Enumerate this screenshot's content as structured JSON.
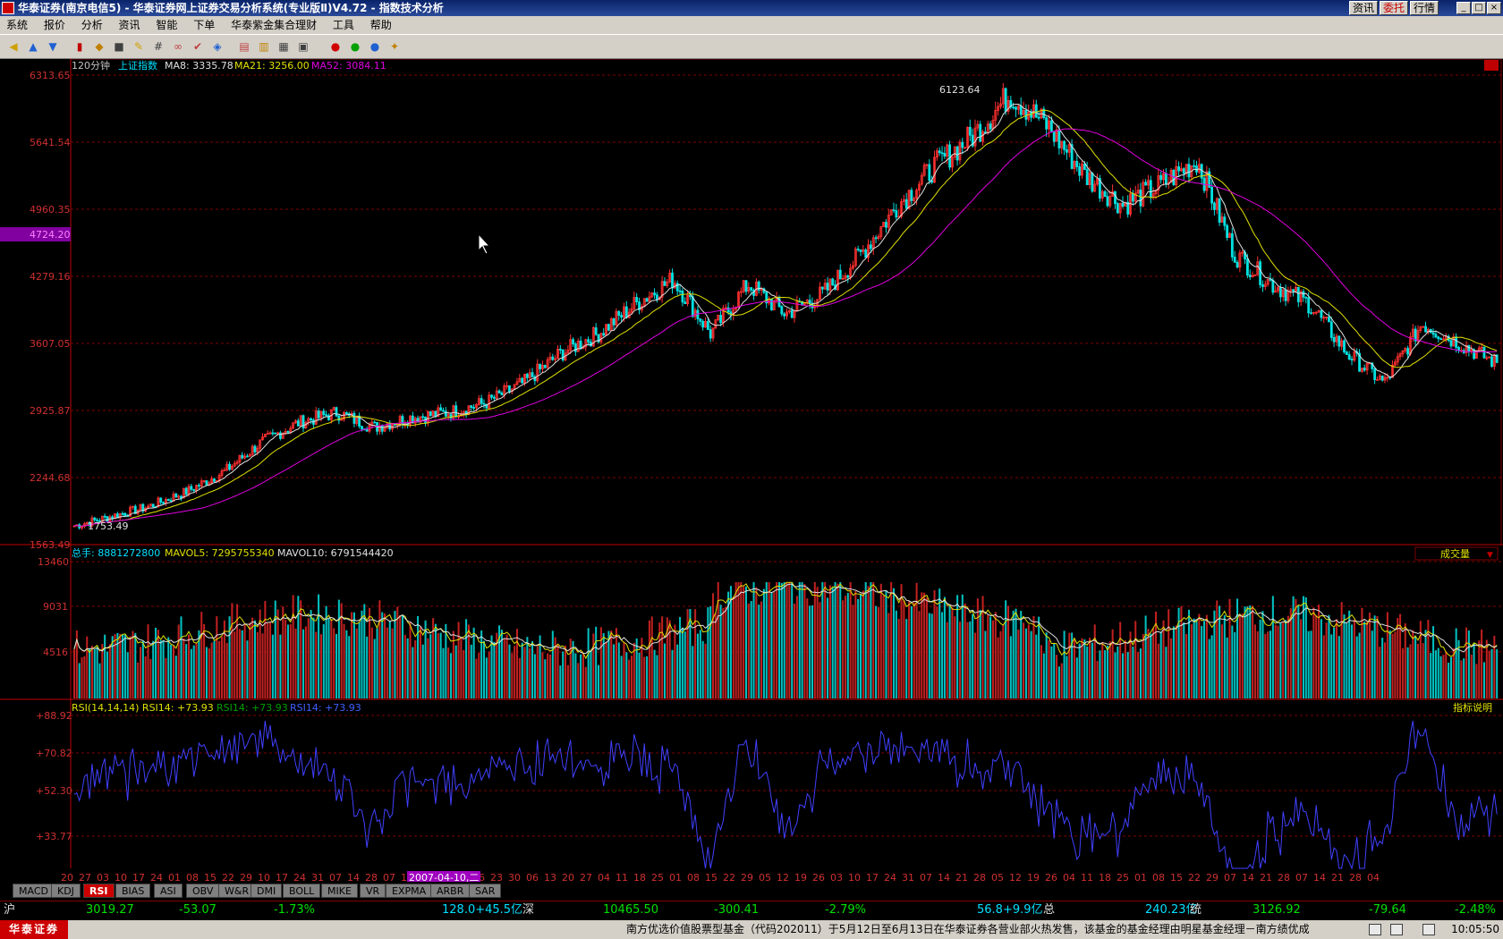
{
  "window": {
    "title": "华泰证券(南京电信5) - 华泰证券网上证券交易分析系统(专业版Ⅱ)V4.72 - 指数技术分析",
    "buttons": [
      "资讯",
      "委托",
      "行情"
    ],
    "controls": [
      "_",
      "□",
      "×"
    ]
  },
  "menu": [
    "系统",
    "报价",
    "分析",
    "资讯",
    "智能",
    "下单",
    "华泰紫金集合理财",
    "工具",
    "帮助"
  ],
  "main_chart": {
    "period": "120分钟",
    "name": "上证指数",
    "ma_legend": [
      {
        "label": "MA8: 3335.78",
        "color": "#e0e0e0"
      },
      {
        "label": "MA21: 3256.00",
        "color": "#e0e000"
      },
      {
        "label": "MA52: 3084.11",
        "color": "#e000e0"
      }
    ],
    "y_ticks": [
      "6313.65",
      "5641.54",
      "4960.35",
      "4279.16",
      "3607.05",
      "2925.87",
      "2244.68",
      "1563.49"
    ],
    "crosshair_value": "4724.20",
    "high_label": "6123.64",
    "low_label": "1753.49"
  },
  "volume_chart": {
    "legend": [
      {
        "label": "总手: 8881272800",
        "color": "#00e0ff"
      },
      {
        "label": "MAVOL5: 7295755340",
        "color": "#e0e000"
      },
      {
        "label": "MAVOL10: 6791544420",
        "color": "#e0e0e0"
      }
    ],
    "y_ticks": [
      "13460",
      "9031",
      "4516"
    ],
    "selector": "成交量"
  },
  "rsi_chart": {
    "legend": [
      {
        "label": "RSI(14,14,14) RSI14: +73.93",
        "color": "#e0e000"
      },
      {
        "label": "RSI14: +73.93",
        "color": "#00a000"
      },
      {
        "label": "RSI14: +73.93",
        "color": "#4040ff"
      }
    ],
    "y_ticks": [
      "+88.92",
      "+70.82",
      "+52.30",
      "+33.77"
    ],
    "help": "指标说明"
  },
  "x_axis": {
    "ticks": [
      "20",
      "27",
      "03",
      "10",
      "17",
      "24",
      "01",
      "08",
      "15",
      "22",
      "29",
      "10",
      "17",
      "24",
      "31",
      "07",
      "14",
      "28",
      "07",
      "1",
      "18",
      "25",
      "09",
      "16",
      "23",
      "30",
      "06",
      "13",
      "20",
      "27",
      "04",
      "11",
      "18",
      "25",
      "01",
      "08",
      "15",
      "22",
      "29",
      "05",
      "12",
      "19",
      "26",
      "03",
      "10",
      "17",
      "24",
      "31",
      "07",
      "14",
      "21",
      "28",
      "05",
      "12",
      "19",
      "26",
      "04",
      "11",
      "18",
      "25",
      "01",
      "08",
      "15",
      "22",
      "29",
      "07",
      "14",
      "21",
      "28",
      "07",
      "14",
      "21",
      "28",
      "04"
    ],
    "cursor_date": "2007-04-10,二"
  },
  "tabs": [
    "MACD",
    "KDJ",
    "RSI",
    "BIAS",
    "ASI",
    "OBV",
    "W&R",
    "DMI",
    "BOLL",
    "MIKE",
    "VR",
    "EXPMA",
    "ARBR",
    "SAR"
  ],
  "active_tab": "RSI",
  "quote_bar": {
    "sh_label": "沪",
    "sh_price": "3019.27",
    "sh_change": "-53.07",
    "sh_pct": "-1.73%",
    "sh_amount": "128.0+45.5亿",
    "sz_label": "深",
    "sz_price": "10465.50",
    "sz_change": "-300.41",
    "sz_pct": "-2.79%",
    "sz_amount": "56.8+9.9亿",
    "total_label": "总",
    "total_amount": "240.23亿",
    "tong_label": "统",
    "tong_price": "3126.92",
    "tong_change": "-79.64",
    "tong_pct": "-2.48%"
  },
  "status": {
    "logo": "华泰证券",
    "ticker": "南方优选价值股票型基金（代码202011）于5月12日至6月13日在华泰证券各营业部火热发售，该基金的基金经理由明星基金经理－南方绩优成",
    "time": "10:05:50"
  },
  "chart_data": {
    "type": "candlestick",
    "series_approx_close": [
      1753,
      1850,
      1950,
      2100,
      2300,
      2600,
      2800,
      2900,
      2750,
      2850,
      2900,
      3000,
      3200,
      3500,
      3700,
      4000,
      4250,
      3700,
      4200,
      3900,
      4100,
      4500,
      5000,
      5400,
      5700,
      6124,
      5800,
      5300,
      5000,
      5200,
      5450,
      4500,
      4200,
      4000,
      3500,
      3200,
      3800,
      3600,
      3400
    ],
    "ylim": [
      1563.49,
      6313.65
    ]
  }
}
